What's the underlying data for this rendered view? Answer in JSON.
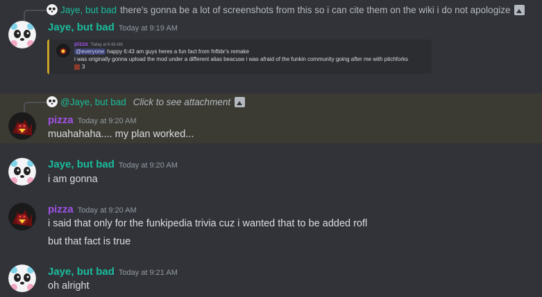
{
  "messages": [
    {
      "reply": {
        "name": "Jaye, but bad",
        "text": "there's gonna be a lot of screenshots from this so i can cite them on the wiki i do not apologize"
      },
      "author": "Jaye, but bad",
      "timestamp": "Today at 9:19 AM",
      "embed": {
        "author": "pizza",
        "timestamp": "Today at 6:43 AM",
        "mention": "@everyone",
        "line1_rest": "happy 6:43 am guys heres a fun fact from fnfbbr's remake",
        "line2": "i was  originally gonna upload the mod under a different alias beacuse i was afraid of the funkin community going after me with pitchforks",
        "reaction_count": "3"
      }
    },
    {
      "reply": {
        "name": "@Jaye, but bad",
        "text": "Click to see attachment"
      },
      "author": "pizza",
      "timestamp": "Today at 9:20 AM",
      "lines": [
        "muahahaha.... my plan worked..."
      ]
    },
    {
      "author": "Jaye, but bad",
      "timestamp": "Today at 9:20 AM",
      "lines": [
        "i am gonna"
      ]
    },
    {
      "author": "pizza",
      "timestamp": "Today at 9:20 AM",
      "lines": [
        "i said that only for the funkipedia trivia cuz i wanted that to be added rofl",
        "but that fact is true"
      ]
    },
    {
      "author": "Jaye, but bad",
      "timestamp": "Today at 9:21 AM",
      "lines": [
        "oh alright"
      ]
    }
  ],
  "colors": {
    "background": "#313338",
    "highlight": "#3c3b33",
    "jaye_name": "#1abc9c",
    "pizza_name": "#a052e8",
    "embed_accent": "#c9a227"
  },
  "icons": {
    "reply_image": "image-icon",
    "jaye_avatar": "panda-avatar",
    "pizza_avatar": "dark-creature-avatar"
  }
}
